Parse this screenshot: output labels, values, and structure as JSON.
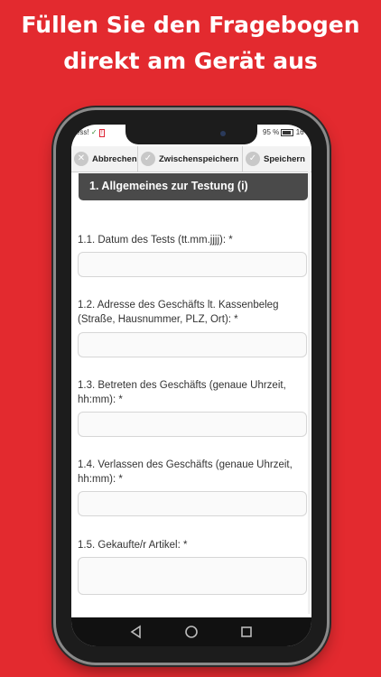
{
  "headline": {
    "line1": "Füllen Sie den Fragebogen",
    "line2": "direkt am Gerät aus"
  },
  "status_bar": {
    "left_text": "ess!",
    "battery_text": "95 %",
    "time_text": "16"
  },
  "toolbar": {
    "cancel_label": "Abbrechen",
    "interim_save_label": "Zwischenspeichern",
    "save_label": "Speichern"
  },
  "section": {
    "title": "1. Allgemeines zur Testung (i)"
  },
  "questions": [
    {
      "label": "1.1. Datum des Tests (tt.mm.jjjj): *",
      "value": ""
    },
    {
      "label": "1.2. Adresse des Geschäfts lt. Kassenbeleg (Straße, Hausnummer, PLZ, Ort): *",
      "value": ""
    },
    {
      "label": "1.3. Betreten des Geschäfts (genaue Uhrzeit, hh:mm):  *",
      "value": ""
    },
    {
      "label": "1.4. Verlassen des Geschäfts (genaue Uhrzeit, hh:mm):  *",
      "value": ""
    },
    {
      "label": "1.5. Gekaufte/r Artikel:  *",
      "value": ""
    }
  ],
  "colors": {
    "background": "#e32a2f",
    "section_header": "#4a4a4a",
    "toolbar": "#f2f2f2"
  },
  "icons": {
    "cancel": "close-circle-icon",
    "interim_save": "check-circle-icon",
    "save": "check-circle-icon",
    "nav_back": "triangle-back-icon",
    "nav_home": "circle-home-icon",
    "nav_recent": "square-recent-icon"
  }
}
